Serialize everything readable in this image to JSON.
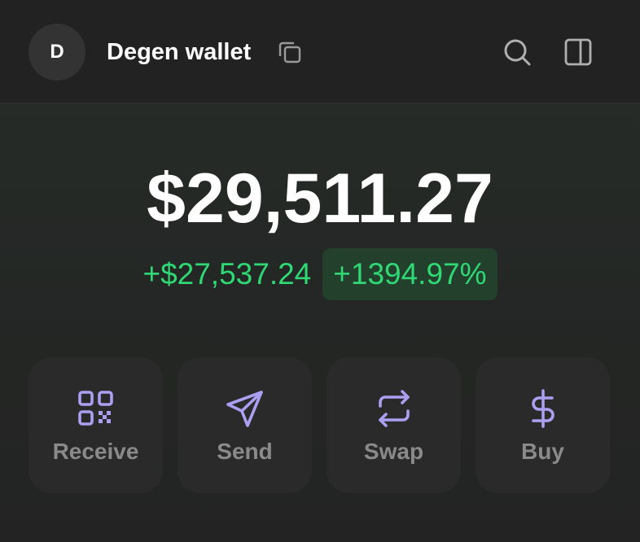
{
  "header": {
    "avatar_initial": "D",
    "wallet_name": "Degen wallet",
    "icons": {
      "copy": "copy-icon",
      "search": "search-icon",
      "panel": "sidebar-panel-icon"
    }
  },
  "balance": {
    "total": "$29,511.27",
    "change_amount": "+$27,537.24",
    "change_percent": "+1394.97%"
  },
  "actions": [
    {
      "label": "Receive",
      "icon": "qr-code-icon"
    },
    {
      "label": "Send",
      "icon": "send-icon"
    },
    {
      "label": "Swap",
      "icon": "swap-icon"
    },
    {
      "label": "Buy",
      "icon": "dollar-icon"
    }
  ],
  "colors": {
    "background": "#222222",
    "positive": "#2fd874",
    "positive_bg": "#23402d",
    "accent": "#ab9ff2",
    "card": "#2a2a2a",
    "muted_text": "#8a8a8a"
  }
}
